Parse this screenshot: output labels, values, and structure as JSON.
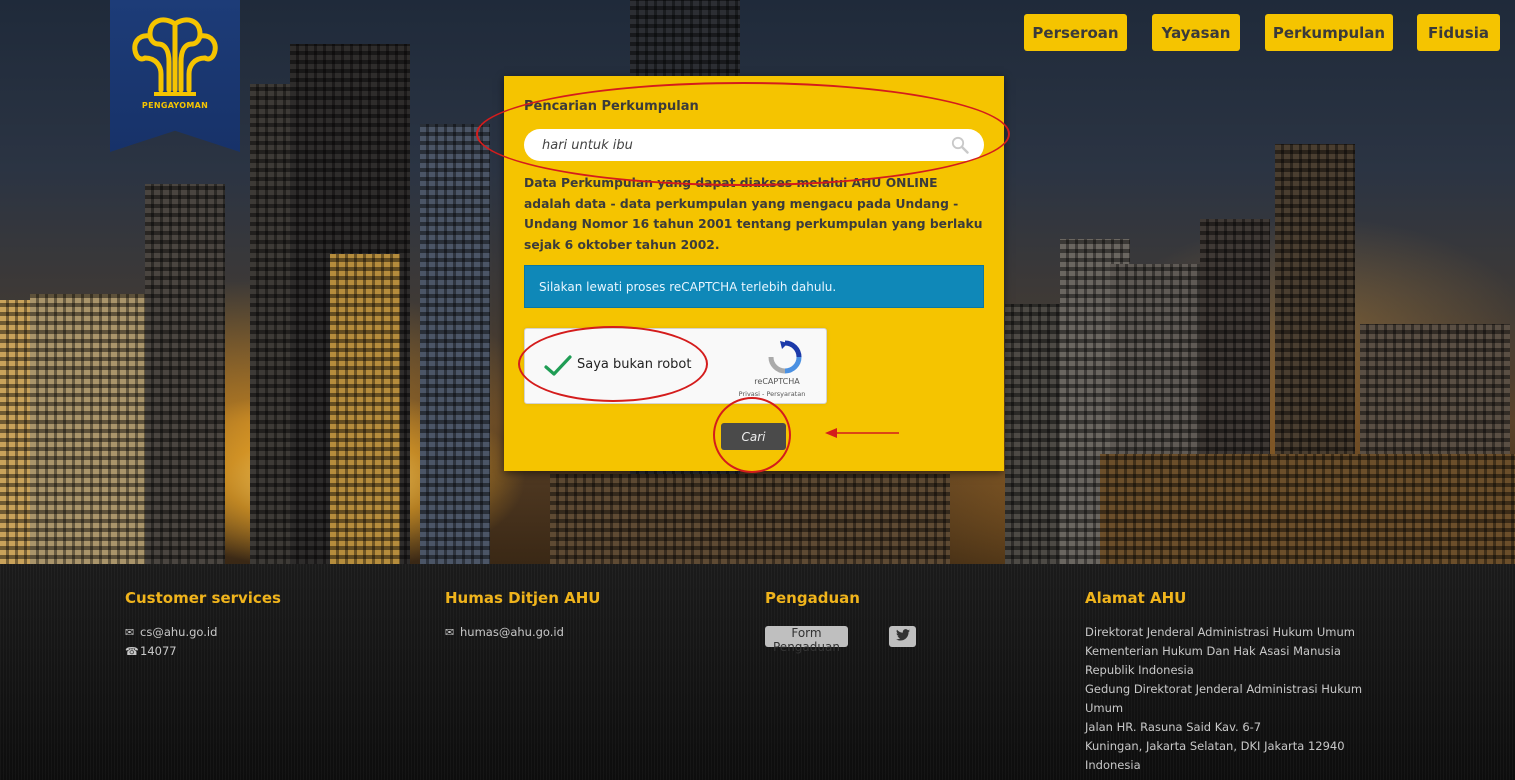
{
  "logo": {
    "text": "PENGAYOMAN"
  },
  "nav": {
    "items": [
      {
        "label": "Perseroan"
      },
      {
        "label": "Yayasan"
      },
      {
        "label": "Perkumpulan"
      },
      {
        "label": "Fidusia"
      }
    ]
  },
  "search": {
    "title": "Pencarian Perkumpulan",
    "value": "hari untuk ibu",
    "description": "Data Perkumpulan yang dapat diakses melalui AHU ONLINE adalah data - data perkumpulan yang mengacu pada Undang - Undang Nomor 16 tahun 2001 tentang perkumpulan yang berlaku sejak 6 oktober tahun 2002.",
    "notice": "Silakan lewati proses reCAPTCHA terlebih dahulu.",
    "submit_label": "Cari"
  },
  "recaptcha": {
    "label": "Saya bukan robot",
    "checked": true,
    "brand": "reCAPTCHA",
    "links": "Privasi - Persyaratan"
  },
  "footer": {
    "customer_services": {
      "heading": "Customer services",
      "email": "cs@ahu.go.id",
      "phone": "14077"
    },
    "humas": {
      "heading": "Humas Ditjen AHU",
      "email": "humas@ahu.go.id"
    },
    "pengaduan": {
      "heading": "Pengaduan",
      "form_label": "Form Pengaduan"
    },
    "alamat": {
      "heading": "Alamat AHU",
      "lines": [
        "Direktorat Jenderal Administrasi Hukum Umum",
        "Kementerian Hukum Dan Hak Asasi Manusia",
        "Republik Indonesia",
        "Gedung Direktorat Jenderal Administrasi Hukum",
        "Umum",
        "Jalan HR. Rasuna Said Kav. 6-7",
        "Kuningan, Jakarta Selatan, DKI Jakarta 12940",
        "Indonesia"
      ]
    }
  },
  "colors": {
    "accent": "#f5c400",
    "footer_heading": "#f0b41c",
    "notice_bg": "#0f88b8",
    "annotation": "#d41c1c"
  }
}
